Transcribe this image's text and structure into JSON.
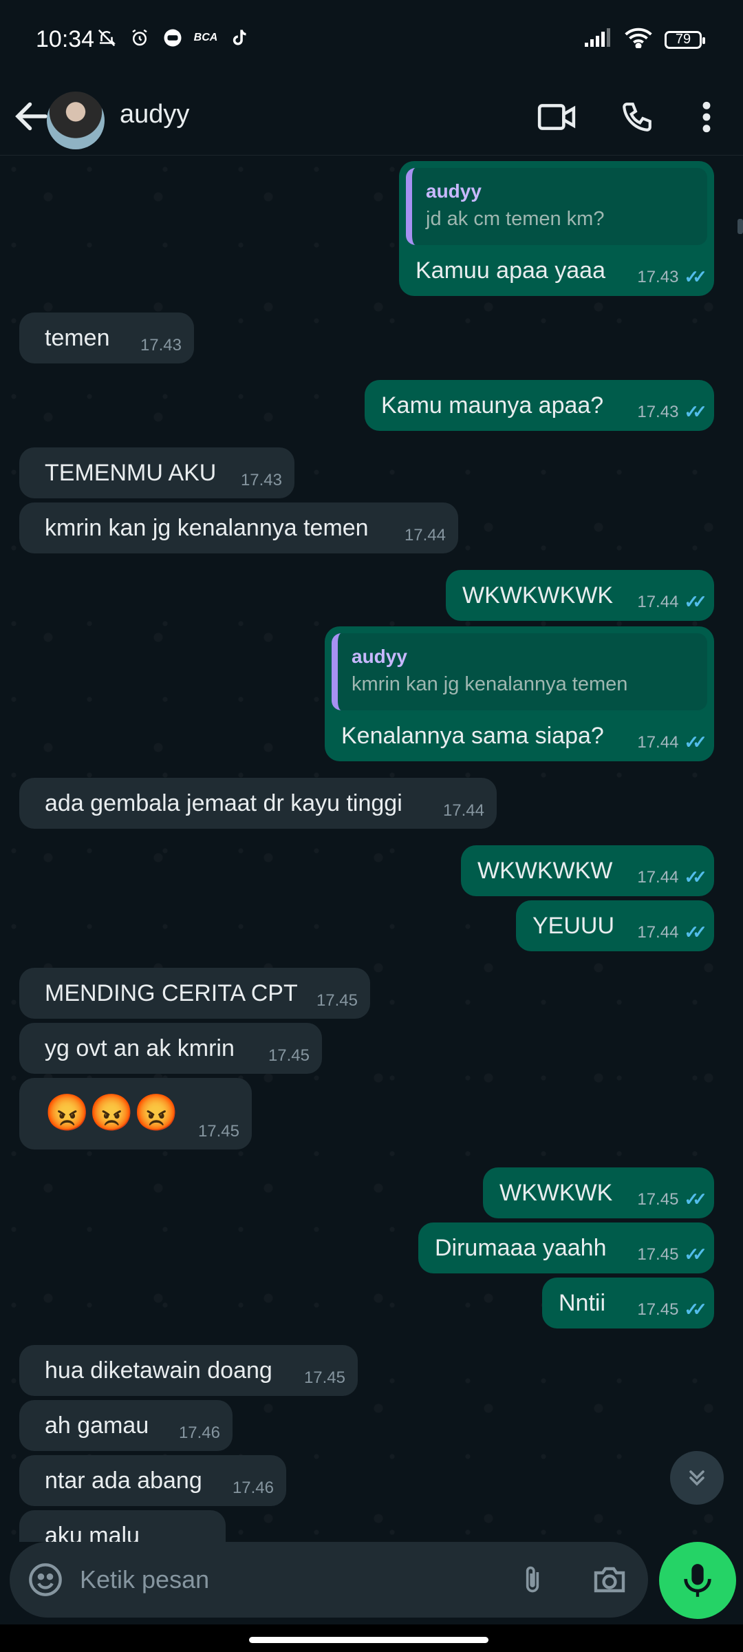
{
  "status_bar": {
    "time": "10:34",
    "battery": "79",
    "bca_label": "BCA"
  },
  "header": {
    "contact_name": "audyy"
  },
  "messages": [
    {
      "dir": "out",
      "reply_name": "audyy",
      "reply_text": "jd ak cm temen km?",
      "text": "Kamuu apaa yaaa",
      "time": "17.43"
    },
    {
      "dir": "in",
      "text": "temen",
      "time": "17.43"
    },
    {
      "dir": "out",
      "text": "Kamu maunya apaa?",
      "time": "17.43"
    },
    {
      "dir": "in",
      "text": "TEMENMU AKU",
      "time": "17.43"
    },
    {
      "dir": "in",
      "text": "kmrin kan jg kenalannya temen",
      "time": "17.44"
    },
    {
      "dir": "out",
      "text": "WKWKWKWK",
      "time": "17.44"
    },
    {
      "dir": "out",
      "reply_name": "audyy",
      "reply_text": "kmrin kan jg kenalannya temen",
      "text": "Kenalannya sama siapa?",
      "time": "17.44"
    },
    {
      "dir": "in",
      "text": "ada gembala jemaat dr kayu tinggi",
      "time": "17.44"
    },
    {
      "dir": "out",
      "text": "WKWKWKW",
      "time": "17.44"
    },
    {
      "dir": "out",
      "text": "YEUUU",
      "time": "17.44"
    },
    {
      "dir": "in",
      "text": "MENDING CERITA CPT",
      "time": "17.45"
    },
    {
      "dir": "in",
      "text": "yg ovt an ak kmrin",
      "time": "17.45"
    },
    {
      "dir": "in",
      "text": "😡😡😡",
      "time": "17.45"
    },
    {
      "dir": "out",
      "text": "WKWKWK",
      "time": "17.45"
    },
    {
      "dir": "out",
      "text": "Dirumaaa yaahh",
      "time": "17.45"
    },
    {
      "dir": "out",
      "text": "Nntii",
      "time": "17.45"
    },
    {
      "dir": "in",
      "text": "hua diketawain doang",
      "time": "17.45"
    },
    {
      "dir": "in",
      "text": "ah gamau",
      "time": "17.46"
    },
    {
      "dir": "in",
      "text": "ntar ada abang",
      "time": "17.46"
    },
    {
      "dir": "in",
      "text": "aku malu",
      "time": ""
    }
  ],
  "composer": {
    "placeholder": "Ketik pesan"
  },
  "colors": {
    "incoming": "#202c33",
    "outgoing": "#005c4b",
    "read_ticks": "#53bdeb",
    "mic_button": "#25d366"
  },
  "icons": [
    "back-arrow-icon",
    "video-call-icon",
    "phone-icon",
    "more-vert-icon",
    "emoji-icon",
    "attach-icon",
    "camera-icon",
    "mic-icon",
    "scroll-down-icon"
  ]
}
